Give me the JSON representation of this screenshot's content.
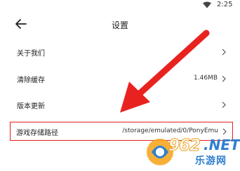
{
  "status_bar": {
    "time": "2:25",
    "icons": [
      "wifi-icon"
    ]
  },
  "header": {
    "title": "设置",
    "back_icon": "arrow-left-icon"
  },
  "settings": {
    "items": [
      {
        "label": "关于我们",
        "value": ""
      },
      {
        "label": "清除缓存",
        "value": "1.46MB"
      },
      {
        "label": "版本更新",
        "value": ""
      },
      {
        "label": "游戏存储路径",
        "value": "/storage/emulated/0/PonyEmu"
      }
    ]
  },
  "annotation": {
    "color": "#e02020",
    "highlighted_item": "游戏存储路径"
  },
  "watermark": {
    "number": "962",
    "net": ".NET",
    "cn": "乐游网"
  }
}
